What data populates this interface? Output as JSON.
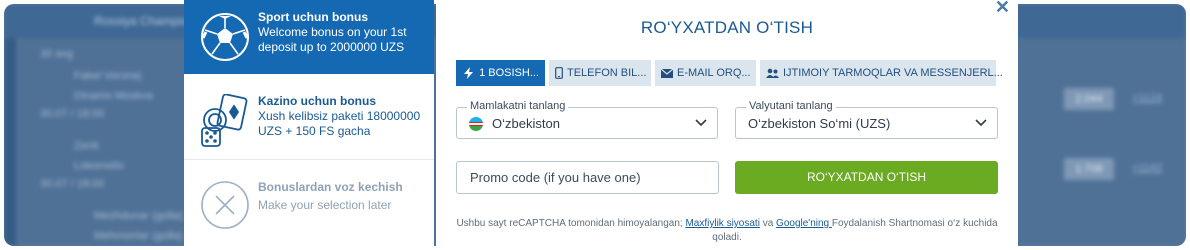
{
  "background": {
    "topbar_label": "Rossiya Championship",
    "day_label": "30 avg",
    "rows": [
      "Fakel Voronej",
      "Dinamo Moskva",
      "Zenit",
      "Lokomotiv",
      "Mezhdunar (golla)",
      "Mehmonlar (golla)"
    ],
    "times": [
      "30.07 / 18:00",
      "30.07 / 18:00"
    ],
    "odds": [
      "2.044",
      "1.708"
    ],
    "links": [
      "+1124",
      "+1142"
    ]
  },
  "bonuses": [
    {
      "title": "Sport uchun bonus",
      "text": "Welcome bonus on your 1st deposit up to 2000000 UZS",
      "icon": "soccer-ball-icon"
    },
    {
      "title": "Kazino uchun bonus",
      "text": "Xush kelibsiz paketi 18000000 UZS + 150 FS gacha",
      "icon": "casino-cards-icon"
    },
    {
      "title": "Bonuslardan voz kechish",
      "text": "Make your selection later",
      "icon": "close-circle-icon"
    }
  ],
  "modal": {
    "title": "RO‘YXATDAN O‘TISH",
    "close_icon": "close-icon",
    "tabs": [
      {
        "label": "1 BOSISH...",
        "icon": "lightning-icon"
      },
      {
        "label": "TELEFON BIL...",
        "icon": "phone-icon"
      },
      {
        "label": "E-MAIL ORQ...",
        "icon": "envelope-icon"
      },
      {
        "label": "IJTIMOIY TARMOQLAR VA MESSENJERL...",
        "icon": "users-icon"
      }
    ],
    "country": {
      "label": "Mamlakatni tanlang",
      "value": "O‘zbekiston"
    },
    "currency": {
      "label": "Valyutani tanlang",
      "value": "O‘zbekiston So‘mi (UZS)"
    },
    "promo_placeholder": "Promo code (if you have one)",
    "register_button": "RO‘YXATDAN O‘TISH",
    "note": {
      "part1": "Ushbu sayt reCAPTCHA tomonidan himoyalangan; ",
      "link1": "Maxfiylik siyosati",
      "part2": " va ",
      "link2": "Google'ning ",
      "part3": "Foydalanish Shartnomasi o‘z kuchida qoladi."
    },
    "colors": {
      "accent": "#1569b3",
      "button": "#6aab22",
      "title": "#1a5a94"
    }
  }
}
